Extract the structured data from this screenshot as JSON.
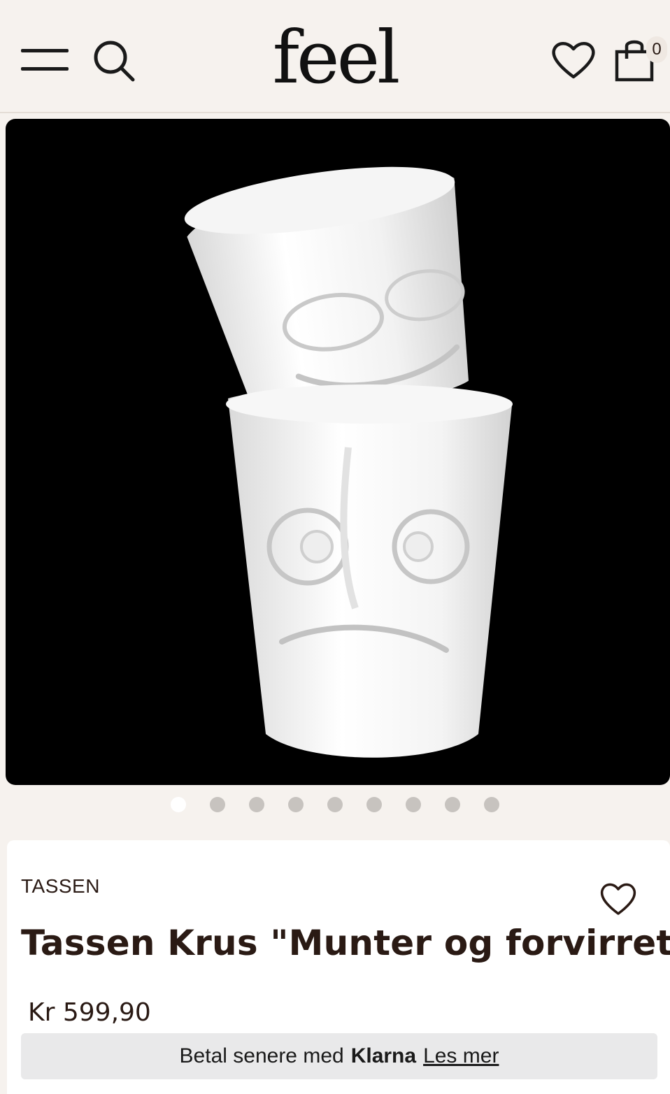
{
  "header": {
    "logo": "feel",
    "cart_count": "0",
    "icons": [
      "menu-icon",
      "search-icon",
      "heart-icon",
      "shopping-bag-icon"
    ]
  },
  "gallery": {
    "image_count": 9,
    "active_index": 0
  },
  "product": {
    "brand": "TASSEN",
    "title": "Tassen Krus \"Munter og forvirret\"",
    "price": "Kr 599,90"
  },
  "klarna": {
    "text": "Betal senere med",
    "brand": "Klarna",
    "link": "Les mer"
  },
  "colors": {
    "background": "#f6f2ee",
    "text": "#2a1a14",
    "dot_inactive": "#c7c3bf",
    "dot_active": "#ffffff",
    "klarna_bar": "#e9e9ea"
  }
}
